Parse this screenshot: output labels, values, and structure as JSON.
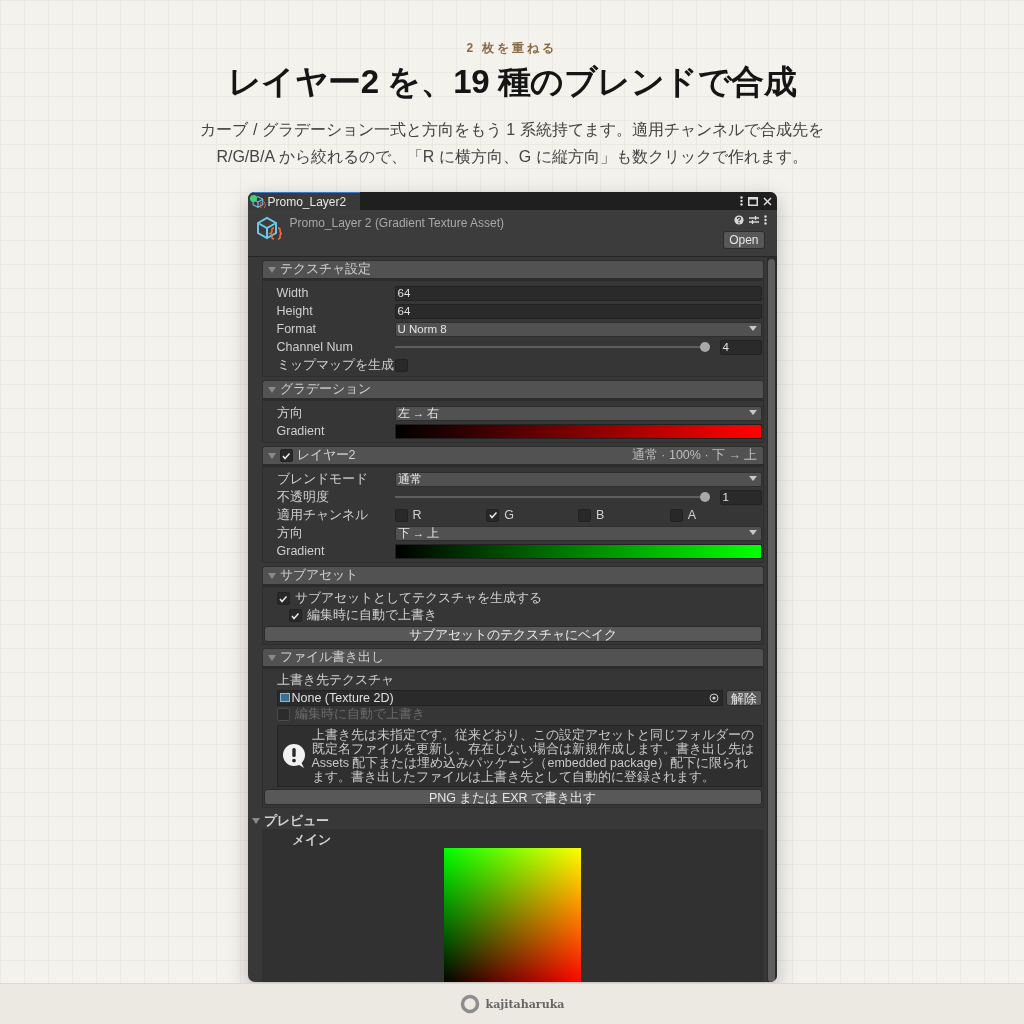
{
  "hero": {
    "eyebrow": "2 枚を重ねる",
    "title": "レイヤー2 を、19 種のブレンドで合成",
    "lead": "カーブ / グラデーション一式と方向をもう 1 系統持てます。適用チャンネルで合成先を R/G/B/A から絞れるので、「R に横方向、G に縦方向」も数クリックで作れます。"
  },
  "inspector": {
    "tab_title": "Promo_Layer2",
    "asset_title": "Promo_Layer 2 (Gradient Texture Asset)",
    "open_button": "Open",
    "sections": [
      {
        "title": "テクスチャ設定",
        "expanded": true,
        "rows": [
          {
            "kind": "number",
            "label": "Width",
            "value": "64"
          },
          {
            "kind": "number",
            "label": "Height",
            "value": "64"
          },
          {
            "kind": "dropdown",
            "label": "Format",
            "value": "U Norm 8"
          },
          {
            "kind": "slider",
            "label": "Channel Num",
            "level": 1,
            "value": "4"
          },
          {
            "kind": "checkbox",
            "label": "ミップマップを生成",
            "checked": false
          }
        ]
      },
      {
        "title": "グラデーション",
        "expanded": true,
        "rows": [
          {
            "kind": "dropdown",
            "label": "方向",
            "value": "左 → 右"
          },
          {
            "kind": "gradient",
            "label": "Gradient",
            "color": "#ff0000"
          }
        ]
      },
      {
        "title": "レイヤー2",
        "expanded": true,
        "enabled": true,
        "summary": "通常 · 100% · 下 → 上",
        "rows": [
          {
            "kind": "dropdown",
            "label": "ブレンドモード",
            "value": "通常"
          },
          {
            "kind": "slider",
            "label": "不透明度",
            "level": 1,
            "value": "1"
          },
          {
            "kind": "channels",
            "label": "適用チャンネル",
            "options": [
              {
                "label": "R",
                "checked": false
              },
              {
                "label": "G",
                "checked": true
              },
              {
                "label": "B",
                "checked": false
              },
              {
                "label": "A",
                "checked": false
              }
            ]
          },
          {
            "kind": "dropdown",
            "label": "方向",
            "value": "下 → 上"
          },
          {
            "kind": "gradient",
            "label": "Gradient",
            "color": "#00ff00"
          }
        ]
      },
      {
        "title": "サブアセット",
        "expanded": true,
        "rows": [
          {
            "kind": "check_option",
            "label": "サブアセットとしてテクスチャを生成する",
            "checked": true,
            "disabled": false,
            "children": [
              {
                "kind": "check_option",
                "label": "編集時に自動で上書き",
                "checked": true,
                "disabled": false
              }
            ]
          },
          {
            "kind": "button",
            "label": "サブアセットのテクスチャにベイク"
          }
        ]
      },
      {
        "title": "ファイル書き出し",
        "expanded": true,
        "rows": [
          {
            "kind": "label",
            "label": "上書き先テクスチャ"
          },
          {
            "kind": "object_field",
            "value": "None (Texture 2D)",
            "button": "解除"
          },
          {
            "kind": "check_option",
            "label": "編集時に自動で上書き",
            "checked": false,
            "disabled": true
          },
          {
            "kind": "help",
            "text": "上書き先は未指定です。従来どおり、この設定アセットと同じフォルダーの既定名ファイルを更新し、存在しない場合は新規作成します。書き出し先は Assets 配下または埋め込みパッケージ（embedded package）配下に限られます。書き出したファイルは上書き先として自動的に登録されます。"
          },
          {
            "kind": "button",
            "label": "PNG または EXR で書き出す"
          }
        ]
      }
    ],
    "preview": {
      "title": "プレビュー",
      "expanded": true,
      "label": "メイン"
    }
  },
  "footer": {
    "brand": "kajitaharuka"
  }
}
